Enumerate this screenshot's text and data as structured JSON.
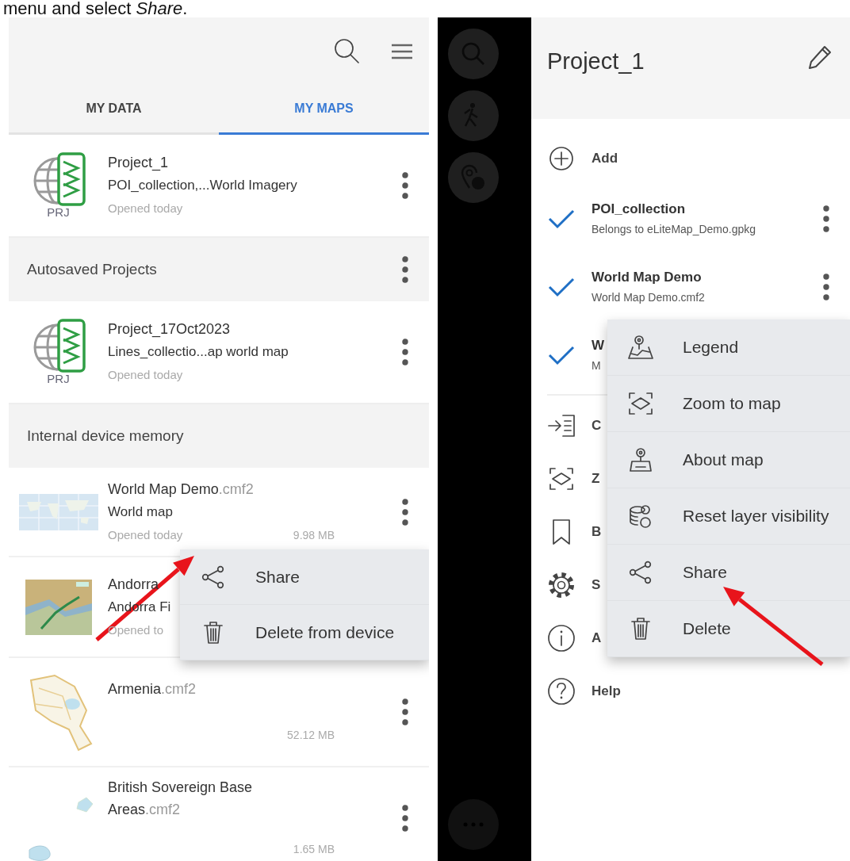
{
  "caption": "menu and select *Share*.",
  "left_screen": {
    "tabs": [
      {
        "label": "MY DATA",
        "selected": false
      },
      {
        "label": "MY MAPS",
        "selected": true
      }
    ],
    "entries": [
      {
        "kind": "project",
        "title": "Project_1",
        "subtitle": "POI_collection,...World Imagery",
        "opened": "Opened today",
        "badge": "PRJ"
      },
      {
        "kind": "section",
        "title": "Autosaved Projects",
        "menu": true
      },
      {
        "kind": "project",
        "title": "Project_17Oct2023",
        "subtitle": "Lines_collectio...ap world map",
        "opened": "Opened today",
        "badge": "PRJ"
      },
      {
        "kind": "section",
        "title": "Internal device memory",
        "menu": false
      },
      {
        "kind": "map",
        "title": "World Map Demo",
        "ext": ".cmf2",
        "subtitle": "World map",
        "opened": "Opened today",
        "size": "9.98 MB"
      },
      {
        "kind": "map",
        "title": "Andorra",
        "subtitle": "Andorra Fi",
        "opened": "Opened to",
        "popup": true
      },
      {
        "kind": "map",
        "title": "Armenia",
        "ext": ".cmf2",
        "size": "52.12 MB"
      },
      {
        "kind": "map",
        "title": "British Sovereign Base Areas",
        "ext": ".cmf2",
        "size": "1.65 MB"
      }
    ],
    "context_menu": [
      {
        "label": "Share"
      },
      {
        "label": "Delete from device"
      }
    ]
  },
  "right_screen": {
    "title": "Project_1",
    "add": {
      "label": "Add"
    },
    "layers": [
      {
        "name": "POI_collection",
        "source": "Belongs to eLiteMap_Demo.gpkg",
        "checked": true,
        "menu": true
      },
      {
        "name": "World Map Demo",
        "source": "World Map Demo.cmf2",
        "checked": true,
        "menu": true
      },
      {
        "name": "W",
        "source": "M",
        "checked": true,
        "menu": false
      }
    ],
    "items": [
      {
        "label": "C"
      },
      {
        "label": "Z"
      },
      {
        "label": "B"
      },
      {
        "label": "S"
      },
      {
        "label": "A"
      },
      {
        "label": "Help"
      }
    ],
    "layer_menu": [
      {
        "label": "Legend"
      },
      {
        "label": "Zoom to map"
      },
      {
        "label": "About map"
      },
      {
        "label": "Reset layer visibility"
      },
      {
        "label": "Share"
      },
      {
        "label": "Delete"
      }
    ]
  }
}
